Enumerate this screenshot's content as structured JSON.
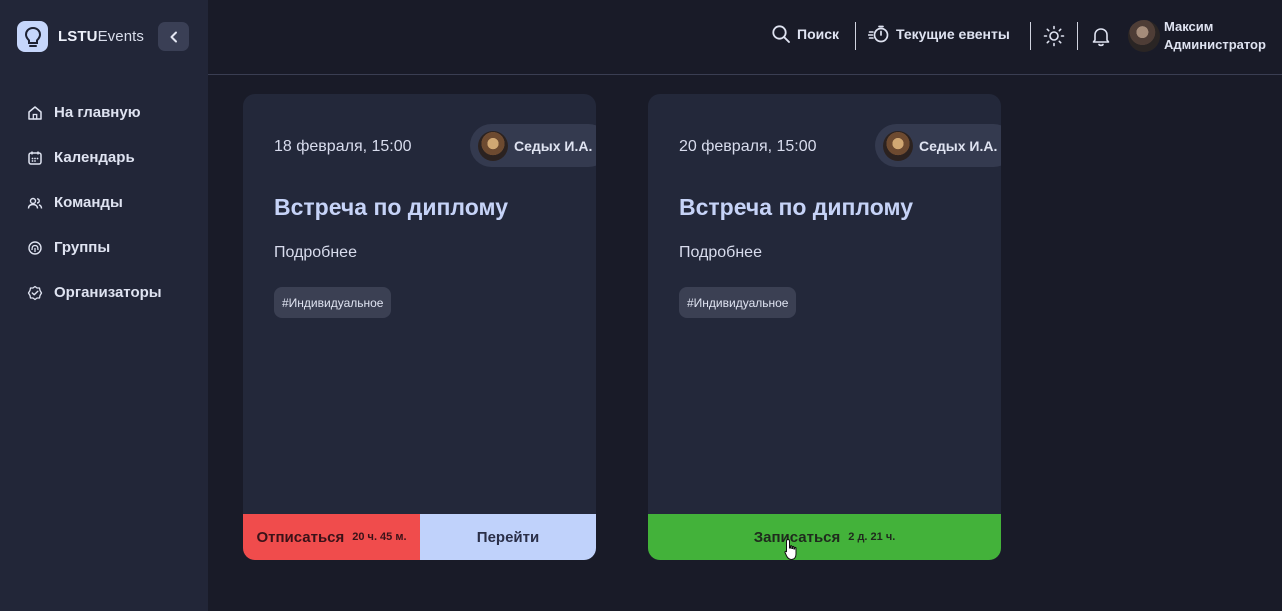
{
  "brand": {
    "bold": "LSTU",
    "light": "Events"
  },
  "sidebar": {
    "items": [
      {
        "label": "На главную",
        "icon": "home-icon"
      },
      {
        "label": "Календарь",
        "icon": "calendar-icon"
      },
      {
        "label": "Команды",
        "icon": "users-icon"
      },
      {
        "label": "Группы",
        "icon": "fingerprint-icon"
      },
      {
        "label": "Организаторы",
        "icon": "badge-check-icon"
      }
    ]
  },
  "header": {
    "search_label": "Поиск",
    "current_events_label": "Текущие евенты",
    "user": {
      "first_name": "Максим",
      "role": "Администратор"
    }
  },
  "cards": [
    {
      "date": "18 февраля, 15:00",
      "author": "Седых И.А.",
      "title": "Встреча по диплому",
      "more": "Подробнее",
      "tag": "#Индивидуальное",
      "unsubscribe_label": "Отписаться",
      "unsubscribe_timer": "20 ч. 45 м.",
      "go_label": "Перейти"
    },
    {
      "date": "20 февраля, 15:00",
      "author": "Седых И.А.",
      "title": "Встреча по диплому",
      "more": "Подробнее",
      "tag": "#Индивидуальное",
      "subscribe_label": "Записаться",
      "subscribe_timer": "2 д. 21 ч."
    }
  ],
  "colors": {
    "background": "#191b28",
    "sidebar": "#222638",
    "card": "#23283a",
    "accent": "#c6d3f7",
    "unsubscribe": "#f04c4c",
    "go": "#c0d2fb",
    "subscribe": "#43b23a"
  }
}
